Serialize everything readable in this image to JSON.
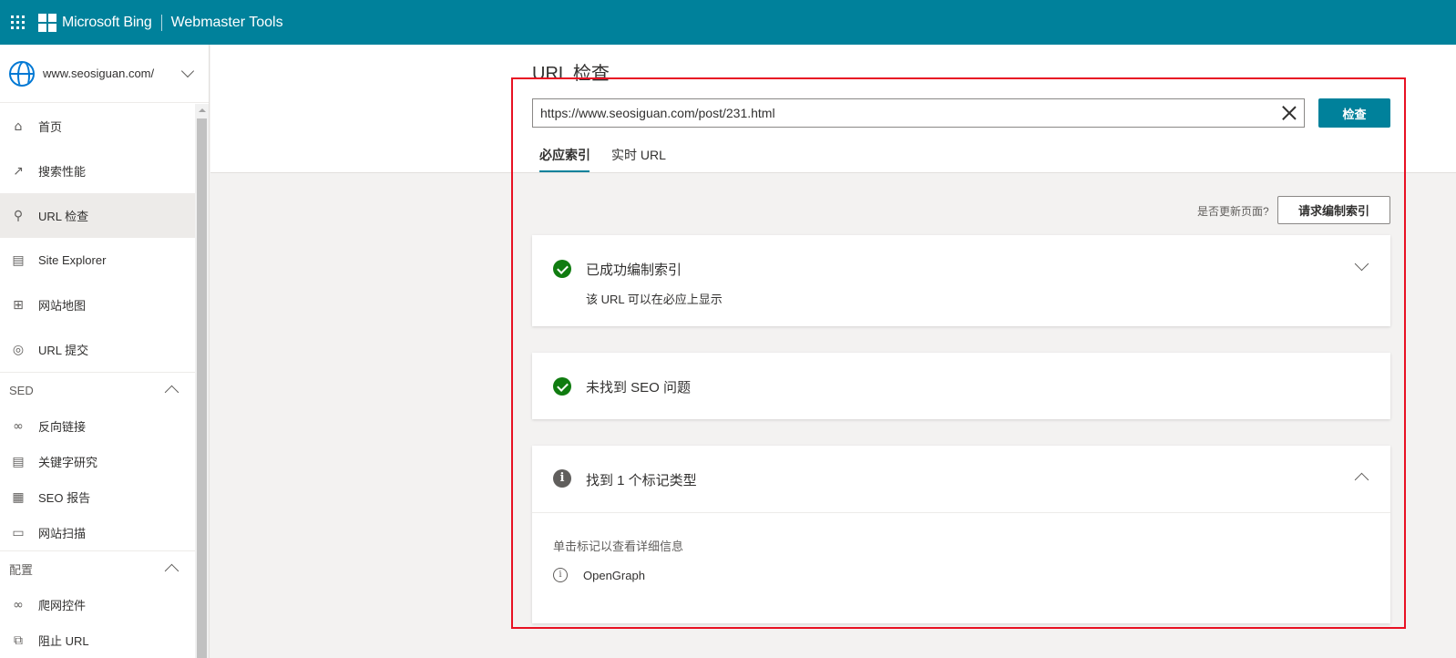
{
  "header": {
    "brand": "Microsoft Bing",
    "product": "Webmaster Tools",
    "bar_color": "#00819b"
  },
  "sidebar": {
    "site": "www.seosiguan.com/",
    "items": [
      {
        "label": "首页",
        "icon": "home-icon"
      },
      {
        "label": "搜索性能",
        "icon": "trend-icon"
      },
      {
        "label": "URL 检查",
        "icon": "search-icon",
        "active": true
      },
      {
        "label": "Site Explorer",
        "icon": "document-icon"
      },
      {
        "label": "网站地图",
        "icon": "sitemap-icon"
      },
      {
        "label": "URL 提交",
        "icon": "globe-icon"
      }
    ],
    "sections": [
      {
        "title": "SED",
        "items": [
          {
            "label": "反向链接",
            "icon": "link-icon"
          },
          {
            "label": "关键字研究",
            "icon": "document-icon"
          },
          {
            "label": "SEO 报告",
            "icon": "report-icon"
          },
          {
            "label": "网站扫描",
            "icon": "scan-icon"
          }
        ]
      },
      {
        "title": "配置",
        "items": [
          {
            "label": "爬网控件",
            "icon": "link-icon"
          },
          {
            "label": "阻止 URL",
            "icon": "block-icon"
          }
        ]
      }
    ]
  },
  "main": {
    "title": "URL 检查",
    "url_value": "https://www.seosiguan.com/post/231.html",
    "inspect_label": "检查",
    "tabs": [
      {
        "label": "必应索引",
        "active": true
      },
      {
        "label": "实时 URL"
      }
    ],
    "ask_update": "是否更新页面?",
    "reindex_label": "请求编制索引",
    "cards": [
      {
        "title": "已成功编制索引",
        "subtitle": "该 URL 可以在必应上显示",
        "status": "success"
      },
      {
        "title": "未找到 SEO 问题",
        "status": "success"
      },
      {
        "title": "找到 1 个标记类型",
        "status": "info",
        "hint": "单击标记以查看详细信息",
        "items": [
          "OpenGraph"
        ]
      }
    ]
  },
  "colors": {
    "accent": "#00819b",
    "success": "#107c10",
    "highlight": "#e81123"
  }
}
